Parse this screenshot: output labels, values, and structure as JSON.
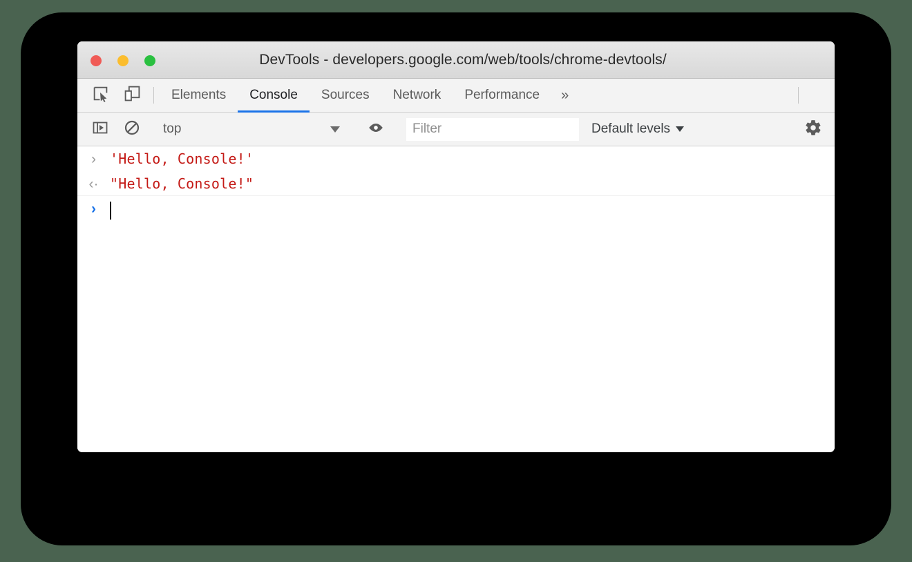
{
  "window": {
    "title": "DevTools - developers.google.com/web/tools/chrome-devtools/",
    "traffic_lights": {
      "close_color": "#f05b56",
      "minimize_color": "#fbbd2e",
      "maximize_color": "#2ac040"
    }
  },
  "theme": {
    "accent": "#1a73e8",
    "toolbar_bg": "#f3f3f3",
    "page_bg": "#4a6350",
    "string_red": "#c41a16"
  },
  "tabbar": {
    "inspect_icon": "inspect-element-icon",
    "device_icon": "device-toolbar-icon",
    "tabs": [
      {
        "label": "Elements",
        "active": false
      },
      {
        "label": "Console",
        "active": true
      },
      {
        "label": "Sources",
        "active": false
      },
      {
        "label": "Network",
        "active": false
      },
      {
        "label": "Performance",
        "active": false
      }
    ],
    "more_tabs_label": "»",
    "menu_icon": "kebab-menu-icon"
  },
  "console_toolbar": {
    "sidebar_icon": "show-console-sidebar-icon",
    "clear_icon": "clear-console-icon",
    "context": {
      "value": "top",
      "caret": "chevron-down-icon"
    },
    "eye_icon": "create-live-expression-icon",
    "filter": {
      "value": "",
      "placeholder": "Filter"
    },
    "levels": {
      "label": "Default levels",
      "caret": "chevron-down-icon"
    },
    "settings_icon": "settings-gear-icon"
  },
  "console": {
    "rows": [
      {
        "gutter": "›",
        "gutter_kind": "input-caret",
        "text": "'Hello, Console!'"
      },
      {
        "gutter": "‹·",
        "gutter_kind": "output-caret",
        "text": "\"Hello, Console!\""
      }
    ],
    "prompt": {
      "gutter": "›",
      "text": ""
    }
  }
}
